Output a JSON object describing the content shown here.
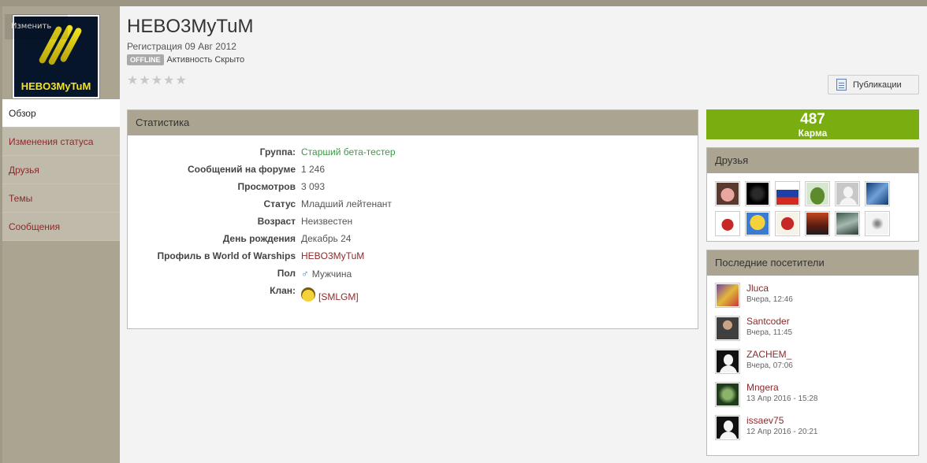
{
  "profile": {
    "change_photo_label": "Изменить",
    "avatar_text": "HEBO3MyTuM",
    "name": "HEBO3MyTuM",
    "registration": "Регистрация 09 Авг 2012",
    "status_badge": "OFFLINE",
    "activity": "Активность Скрыто",
    "rating_stars": 5,
    "rating_value": 0
  },
  "nav": {
    "items": [
      {
        "label": "Обзор",
        "active": true
      },
      {
        "label": "Изменения статуса"
      },
      {
        "label": "Друзья"
      },
      {
        "label": "Темы"
      },
      {
        "label": "Сообщения"
      }
    ]
  },
  "actions": {
    "publications_label": "Публикации"
  },
  "stats": {
    "title": "Статистика",
    "rows": [
      {
        "label": "Группа:",
        "value": "Старший бета-тестер"
      },
      {
        "label": "Сообщений на форуме",
        "value": "1 246"
      },
      {
        "label": "Просмотров",
        "value": "3 093"
      },
      {
        "label": "Статус",
        "value": "Младший лейтенант"
      },
      {
        "label": "Возраст",
        "value": "Неизвестен"
      },
      {
        "label": "День рождения",
        "value": "Декабрь 24"
      },
      {
        "label": "Профиль в World of Warships",
        "value": "HEBO3MyTuM"
      },
      {
        "label": "Пол",
        "value": "Мужчина"
      },
      {
        "label": "Клан:",
        "value": "[SMLGM]"
      }
    ]
  },
  "karma": {
    "value": "487",
    "label": "Карма"
  },
  "friends": {
    "title": "Друзья",
    "avatars": [
      "pig",
      "black-cat",
      "flag",
      "tank",
      "default",
      "wing",
      "panda",
      "simpson",
      "red-star",
      "sunset",
      "stormy-sea",
      "drawing"
    ]
  },
  "visitors": {
    "title": "Последние посетители",
    "items": [
      {
        "name": "Jluca",
        "time": "Вчера, 12:46",
        "avatar": "colorful"
      },
      {
        "name": "Santcoder",
        "time": "Вчера, 11:45",
        "avatar": "photo"
      },
      {
        "name": "ZACHEM_",
        "time": "Вчера, 07:06",
        "avatar": "default"
      },
      {
        "name": "Mngera",
        "time": "13 Апр 2016 - 15:28",
        "avatar": "green-face"
      },
      {
        "name": "issaev75",
        "time": "12 Апр 2016 - 20:21",
        "avatar": "default"
      }
    ]
  }
}
